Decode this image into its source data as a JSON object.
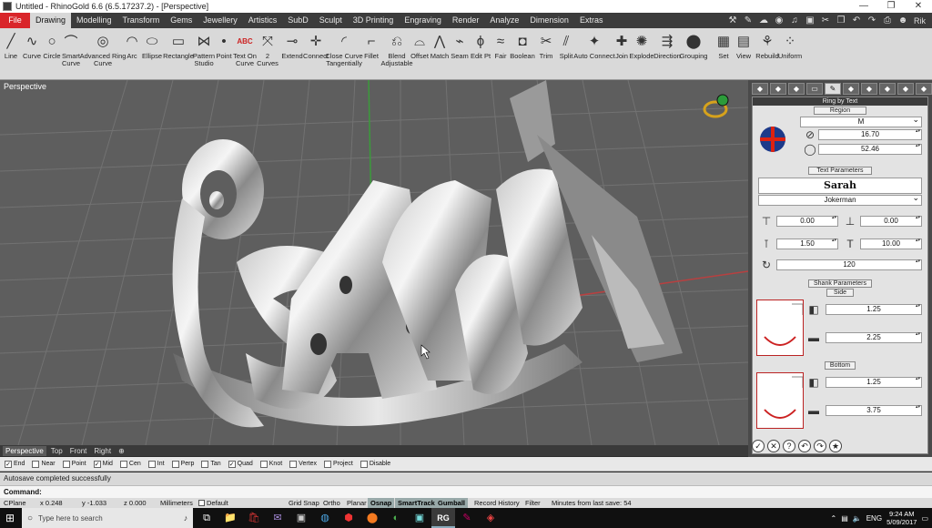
{
  "window": {
    "title": "Untitled - RhinoGold 6.6 (6.5.17237.2) - [Perspective]",
    "controls": [
      "—",
      "❐",
      "✕"
    ]
  },
  "menubar": {
    "file": "File",
    "tabs": [
      "Drawing",
      "Modelling",
      "Transform",
      "Gems",
      "Jewellery",
      "Artistics",
      "SubD",
      "Sculpt",
      "3D Printing",
      "Engraving",
      "Render",
      "Analyze",
      "Dimension",
      "Extras"
    ],
    "user": "Rik"
  },
  "ribbon": [
    {
      "label": "Line",
      "icon": "╱"
    },
    {
      "label": "Curve",
      "icon": "∿"
    },
    {
      "label": "Circle",
      "icon": "○"
    },
    {
      "label": "Smart\nCurve",
      "icon": "⌒"
    },
    {
      "label": "Advanced Ring\nCurve",
      "icon": "◎"
    },
    {
      "label": "Arc",
      "icon": "◠"
    },
    {
      "label": "Ellipse",
      "icon": "⬭"
    },
    {
      "label": "Rectangle",
      "icon": "▭"
    },
    {
      "label": "Pattern\nStudio",
      "icon": "⋈"
    },
    {
      "label": "Point",
      "icon": "•"
    },
    {
      "label": "Text On\nCurve",
      "icon": "ABC"
    },
    {
      "label": "2\nCurves",
      "icon": "⤧"
    },
    {
      "label": "Extend",
      "icon": "⊸"
    },
    {
      "label": "Connect",
      "icon": "✛"
    },
    {
      "label": "Close Curve\nTangentially",
      "icon": "◜"
    },
    {
      "label": "Fillet",
      "icon": "⌐"
    },
    {
      "label": "Blend\nAdjustable",
      "icon": "⎌"
    },
    {
      "label": "Offset",
      "icon": "⌓"
    },
    {
      "label": "Match",
      "icon": "⋀"
    },
    {
      "label": "Seam",
      "icon": "⌁"
    },
    {
      "label": "Edit Pt",
      "icon": "ϕ"
    },
    {
      "label": "Fair",
      "icon": "≈"
    },
    {
      "label": "Boolean",
      "icon": "◘"
    },
    {
      "label": "Trim",
      "icon": "✂"
    },
    {
      "label": "Split",
      "icon": "⫽"
    },
    {
      "label": "Auto Connect",
      "icon": "✦"
    },
    {
      "label": "Join",
      "icon": "✚"
    },
    {
      "label": "Explode",
      "icon": "✺"
    },
    {
      "label": "Direction",
      "icon": "⇶"
    },
    {
      "label": "Grouping",
      "icon": "⬤"
    },
    {
      "label": "Set",
      "icon": "▦"
    },
    {
      "label": "View",
      "icon": "▤"
    },
    {
      "label": "Rebuild",
      "icon": "⚘"
    },
    {
      "label": "Uniform",
      "icon": "⁘"
    }
  ],
  "viewport": {
    "label": "Perspective",
    "text": "Sarah"
  },
  "panel": {
    "tabs": [
      "◆",
      "◆",
      "◆",
      "▭",
      "✎",
      "◆",
      "◆",
      "◆",
      "◆",
      "◆"
    ],
    "title": "Ring by Text",
    "region": {
      "heading": "Region",
      "size": "M",
      "diameter": "16.70",
      "circumference": "52.46"
    },
    "text": {
      "heading": "Text Parameters",
      "value": "Sarah",
      "font": "Jokerman",
      "offset_x": "0.00",
      "offset_y": "0.00",
      "thickness": "1.50",
      "height": "10.00",
      "angle": "120"
    },
    "shank": {
      "heading": "Shank Parameters",
      "side": {
        "heading": "Side",
        "width": "1.25",
        "thickness": "2.25"
      },
      "bottom": {
        "heading": "Bottom",
        "width": "1.25",
        "thickness": "3.75"
      }
    },
    "actions": [
      "✓",
      "✕",
      "?",
      "↶",
      "↷",
      "★"
    ]
  },
  "viewtabs": [
    "Perspective",
    "Top",
    "Front",
    "Right",
    "⊕"
  ],
  "osnaps": [
    {
      "label": "End",
      "checked": true
    },
    {
      "label": "Near",
      "checked": false
    },
    {
      "label": "Point",
      "checked": false
    },
    {
      "label": "Mid",
      "checked": true
    },
    {
      "label": "Cen",
      "checked": false
    },
    {
      "label": "Int",
      "checked": false
    },
    {
      "label": "Perp",
      "checked": false
    },
    {
      "label": "Tan",
      "checked": false
    },
    {
      "label": "Quad",
      "checked": true
    },
    {
      "label": "Knot",
      "checked": false
    },
    {
      "label": "Vertex",
      "checked": false
    },
    {
      "label": "Project",
      "checked": false
    },
    {
      "label": "Disable",
      "checked": false
    }
  ],
  "command": {
    "history": "Autosave completed successfully",
    "prompt": "Command:"
  },
  "status": {
    "cplane": "CPlane",
    "x": "x 0.248",
    "y": "y -1.033",
    "z": "z 0.000",
    "units": "Millimeters",
    "layer": "Default",
    "panes": [
      "Grid Snap",
      "Ortho",
      "Planar",
      "Osnap",
      "SmartTrack",
      "Gumball",
      "Record History",
      "Filter"
    ],
    "active_panes": [
      "Osnap",
      "SmartTrack",
      "Gumball"
    ],
    "save_info": "Minutes from last save: 54"
  },
  "taskbar": {
    "search_placeholder": "Type here to search",
    "apps": [
      "⧉",
      "📁",
      "🛍",
      "✉",
      "▣",
      "◍",
      "⬢",
      "⬤",
      "◐",
      "▣",
      "RG",
      "✎",
      "◈"
    ],
    "language": "ENG",
    "time": "9:24 AM",
    "date": "5/09/2017"
  }
}
